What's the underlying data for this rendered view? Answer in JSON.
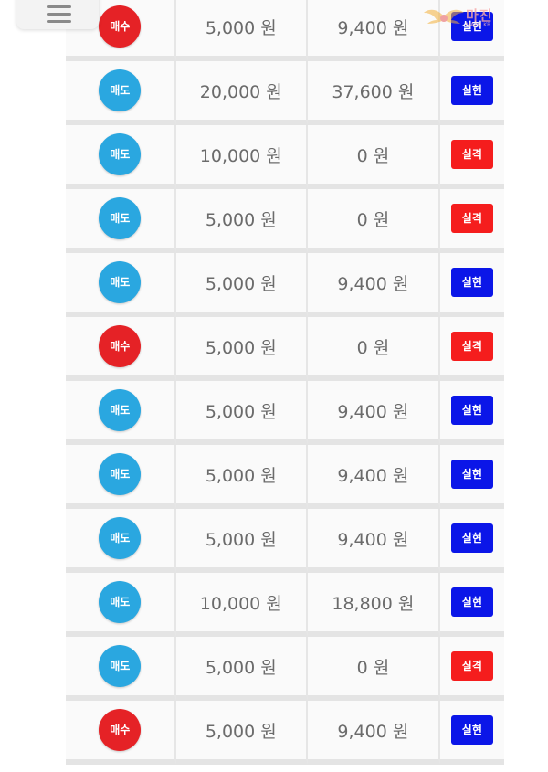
{
  "colors": {
    "buy": "#e52226",
    "sell": "#2aa7e0",
    "success": "#0b16e8",
    "fail": "#f51d1d"
  },
  "header": {
    "menu_icon": "hamburger-menu-icon",
    "watermark_text": "마진",
    "watermark_sub": "MAJIN.KR"
  },
  "rows": [
    {
      "type": "매수",
      "kind": "buy",
      "amount": "5,000 원",
      "return": "9,400 원",
      "result": "실현",
      "status": "success"
    },
    {
      "type": "매도",
      "kind": "sell",
      "amount": "20,000 원",
      "return": "37,600 원",
      "result": "실현",
      "status": "success"
    },
    {
      "type": "매도",
      "kind": "sell",
      "amount": "10,000 원",
      "return": "0 원",
      "result": "실격",
      "status": "fail"
    },
    {
      "type": "매도",
      "kind": "sell",
      "amount": "5,000 원",
      "return": "0 원",
      "result": "실격",
      "status": "fail"
    },
    {
      "type": "매도",
      "kind": "sell",
      "amount": "5,000 원",
      "return": "9,400 원",
      "result": "실현",
      "status": "success"
    },
    {
      "type": "매수",
      "kind": "buy",
      "amount": "5,000 원",
      "return": "0 원",
      "result": "실격",
      "status": "fail"
    },
    {
      "type": "매도",
      "kind": "sell",
      "amount": "5,000 원",
      "return": "9,400 원",
      "result": "실현",
      "status": "success"
    },
    {
      "type": "매도",
      "kind": "sell",
      "amount": "5,000 원",
      "return": "9,400 원",
      "result": "실현",
      "status": "success"
    },
    {
      "type": "매도",
      "kind": "sell",
      "amount": "5,000 원",
      "return": "9,400 원",
      "result": "실현",
      "status": "success"
    },
    {
      "type": "매도",
      "kind": "sell",
      "amount": "10,000 원",
      "return": "18,800 원",
      "result": "실현",
      "status": "success"
    },
    {
      "type": "매도",
      "kind": "sell",
      "amount": "5,000 원",
      "return": "0 원",
      "result": "실격",
      "status": "fail"
    },
    {
      "type": "매수",
      "kind": "buy",
      "amount": "5,000 원",
      "return": "9,400 원",
      "result": "실현",
      "status": "success"
    }
  ]
}
